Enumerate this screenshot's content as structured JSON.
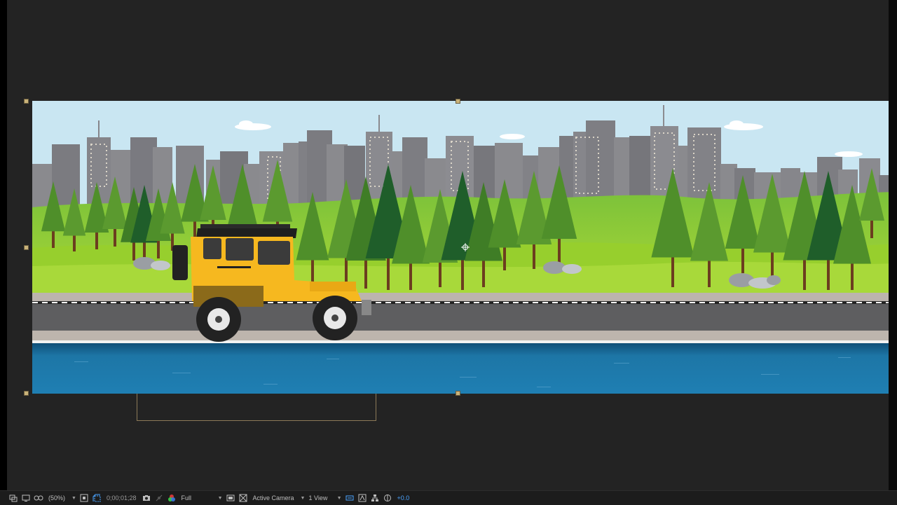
{
  "viewer": {
    "zoom_label": "(50%)",
    "timecode": "0;00;01;28",
    "resolution_label": "Full",
    "camera_label": "Active Camera",
    "view_layout_label": "1 View",
    "exposure_value": "+0.0"
  },
  "colors": {
    "panel_bg": "#232323",
    "selection_handle": "#c9b37a",
    "sky": "#c9e6f2",
    "grass": "#8ccb2c",
    "road": "#5e5e60",
    "water": "#1d76a6",
    "jeep_body": "#f6b81f",
    "exposure_accent": "#4aa3ff"
  },
  "icons": {
    "toolbar": [
      "always-preview-icon",
      "monitor-icon",
      "mask-visibility-icon",
      "magnification-dropdown",
      "region-of-interest-icon",
      "transparency-grid-icon",
      "snapshot-camera-icon",
      "show-snapshot-icon",
      "color-channel-icon",
      "toggle-view-icon",
      "transparency-icon",
      "3d-view-icon",
      "fast-preview-icon",
      "flowchart-icon",
      "reset-exposure-icon"
    ]
  }
}
